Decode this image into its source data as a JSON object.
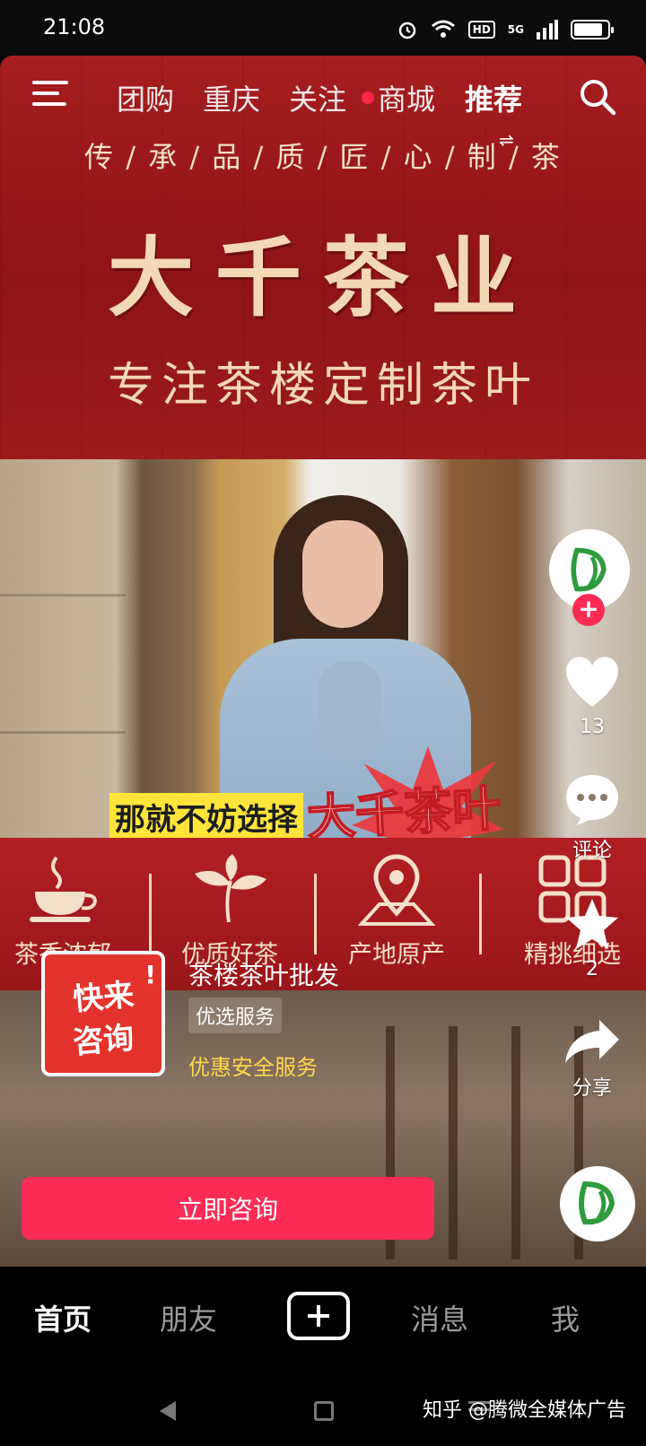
{
  "status_bar": {
    "time": "21:08",
    "hd": "HD",
    "network": "5G",
    "battery_level": 0.85
  },
  "top_nav": {
    "tabs": [
      "团购",
      "重庆",
      "关注",
      "商城",
      "推荐"
    ],
    "active_tab": "推荐",
    "active_indicator": "⇌"
  },
  "video": {
    "slogan": "传 / 承 / 品 / 质 / 匠 / 心 / 制 / 茶",
    "brand_title": "大千茶业",
    "brand_subtitle": "专注茶楼定制茶叶",
    "caption_prefix": "那就不妨选择",
    "caption_brand": "大千茶叶",
    "features": [
      "茶香浓郁",
      "优质好茶",
      "产地原产",
      "精挑细选"
    ]
  },
  "actions": {
    "likes": "13",
    "comment_label": "评论",
    "favorites": "2",
    "share_label": "分享",
    "follow_symbol": "+"
  },
  "ad": {
    "thumb_line1": "快来",
    "thumb_line2": "咨询",
    "thumb_bang": "!",
    "title": "茶楼茶叶批发",
    "tag": "优选服务",
    "service": "优惠安全服务",
    "cta": "立即咨询"
  },
  "bottom_nav": {
    "items": [
      "首页",
      "朋友",
      "消息",
      "我"
    ],
    "active": "首页"
  },
  "watermark": "知乎 @腾微全媒体广告",
  "colors": {
    "brand_red": "#9e1a1d",
    "cta_pink": "#fe2c55",
    "gold_text": "#f3d8b6",
    "service_yellow": "#ffd84d"
  }
}
